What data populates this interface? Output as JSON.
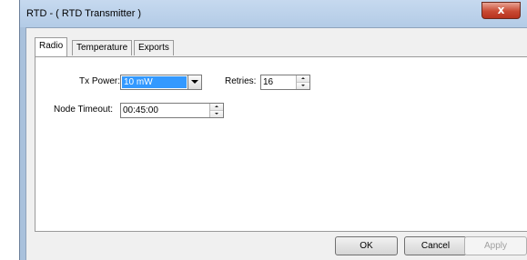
{
  "window": {
    "title": "RTD - ( RTD Transmitter )",
    "close_glyph": "x"
  },
  "tabs": [
    {
      "label": "Radio",
      "active": true
    },
    {
      "label": "Temperature",
      "active": false
    },
    {
      "label": "Exports",
      "active": false
    }
  ],
  "radio": {
    "tx_power": {
      "label": "Tx Power:",
      "value": "10 mW"
    },
    "retries": {
      "label": "Retries:",
      "value": "16"
    },
    "node_timeout": {
      "label": "Node Timeout:",
      "value": "00:45:00"
    }
  },
  "buttons": {
    "ok": "OK",
    "cancel": "Cancel",
    "apply": "Apply"
  },
  "colors": {
    "selection": "#3399ff",
    "title_bar": "#b3cbe6",
    "close_button": "#c94a33"
  }
}
